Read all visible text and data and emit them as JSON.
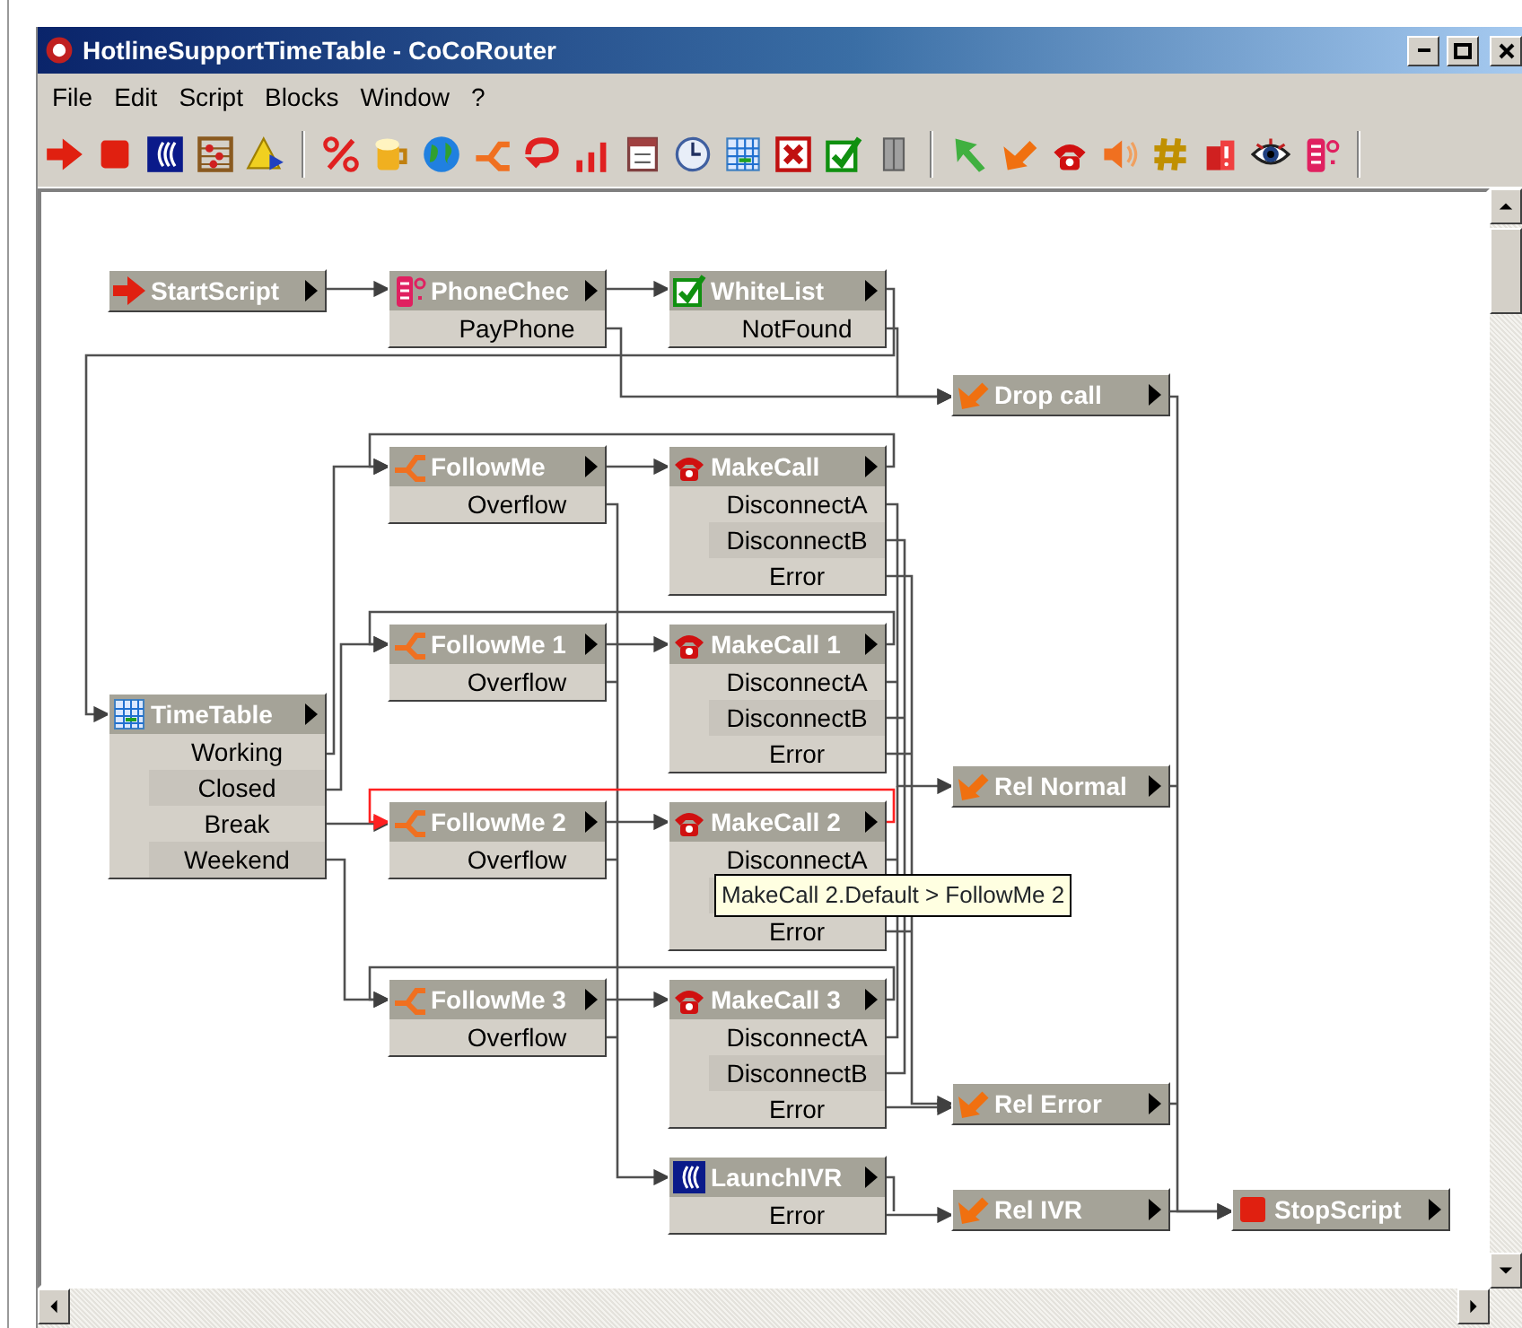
{
  "window": {
    "title": "HotlineSupportTimeTable - CoCoRouter"
  },
  "menu": [
    {
      "label": "File"
    },
    {
      "label": "Edit"
    },
    {
      "label": "Script"
    },
    {
      "label": "Blocks"
    },
    {
      "label": "Window"
    },
    {
      "label": "?"
    }
  ],
  "blocks": [
    {
      "kind": "start",
      "title": "StartScript"
    },
    {
      "kind": "phone_check",
      "title": "PhoneChec",
      "outputs": [
        "PayPhone"
      ]
    },
    {
      "kind": "whitelist",
      "title": "WhiteList",
      "outputs": [
        "NotFound"
      ]
    },
    {
      "kind": "release",
      "title": "Drop call"
    },
    {
      "kind": "follow_me",
      "title": "FollowMe",
      "outputs": [
        "Overflow"
      ]
    },
    {
      "kind": "make_call",
      "title": "MakeCall",
      "outputs": [
        "DisconnectA",
        "DisconnectB",
        "Error"
      ]
    },
    {
      "kind": "follow_me",
      "title": "FollowMe 1",
      "outputs": [
        "Overflow"
      ]
    },
    {
      "kind": "make_call",
      "title": "MakeCall 1",
      "outputs": [
        "DisconnectA",
        "DisconnectB",
        "Error"
      ]
    },
    {
      "kind": "time_table",
      "title": "TimeTable",
      "outputs": [
        "Working",
        "Closed",
        "Break",
        "Weekend"
      ]
    },
    {
      "kind": "release",
      "title": "Rel Normal"
    },
    {
      "kind": "follow_me",
      "title": "FollowMe 2",
      "outputs": [
        "Overflow"
      ]
    },
    {
      "kind": "make_call",
      "title": "MakeCall 2",
      "outputs": [
        "DisconnectA",
        "Error"
      ],
      "tooltip": {
        "text": "MakeCall 2.Default > FollowMe 2",
        "link_highlighted": true
      }
    },
    {
      "kind": "follow_me",
      "title": "FollowMe 3",
      "outputs": [
        "Overflow"
      ]
    },
    {
      "kind": "make_call",
      "title": "MakeCall 3",
      "outputs": [
        "DisconnectA",
        "DisconnectB",
        "Error"
      ]
    },
    {
      "kind": "release",
      "title": "Rel Error"
    },
    {
      "kind": "launch_ivr",
      "title": "LaunchIVR",
      "outputs": [
        "Error"
      ]
    },
    {
      "kind": "release",
      "title": "Rel IVR"
    },
    {
      "kind": "stop",
      "title": "StopScript"
    }
  ]
}
